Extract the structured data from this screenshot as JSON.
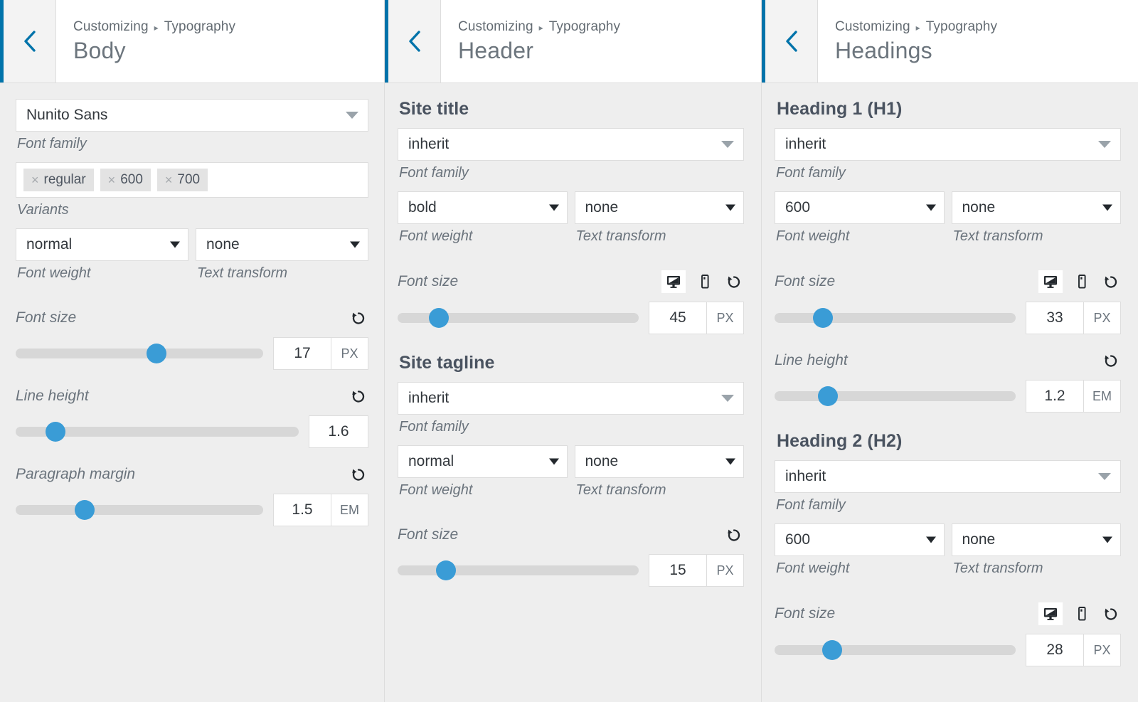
{
  "panels": [
    {
      "accent_color": "#0073aa",
      "back_icon": "chevron-left-icon",
      "breadcrumb": {
        "root": "Customizing",
        "separator": "▸",
        "section": "Typography"
      },
      "title": "Body",
      "font_family": {
        "value": "Nunito Sans",
        "label": "Font family"
      },
      "variants": {
        "chips": [
          "regular",
          "600",
          "700"
        ],
        "remove_glyph": "×",
        "label": "Variants"
      },
      "weight": {
        "value": "normal",
        "label": "Font weight"
      },
      "transform": {
        "value": "none",
        "label": "Text transform"
      },
      "sliders": [
        {
          "label": "Font size",
          "value": "17",
          "unit": "PX",
          "percent": 57,
          "reset_icon": "reset-icon",
          "devices": false
        },
        {
          "label": "Line height",
          "value": "1.6",
          "unit": "",
          "percent": 14,
          "reset_icon": "reset-icon",
          "devices": false
        },
        {
          "label": "Paragraph margin",
          "value": "1.5",
          "unit": "EM",
          "percent": 28,
          "reset_icon": "reset-icon",
          "devices": false
        }
      ]
    },
    {
      "accent_color": "#0073aa",
      "back_icon": "chevron-left-icon",
      "breadcrumb": {
        "root": "Customizing",
        "separator": "▸",
        "section": "Typography"
      },
      "title": "Header",
      "sections": [
        {
          "heading": "Site title",
          "font_family": {
            "value": "inherit",
            "label": "Font family"
          },
          "weight": {
            "value": "bold",
            "label": "Font weight"
          },
          "transform": {
            "value": "none",
            "label": "Text transform"
          },
          "font_size": {
            "label": "Font size",
            "value": "45",
            "unit": "PX",
            "percent": 17,
            "devices": true,
            "desktop_icon": "desktop-icon",
            "mobile_icon": "mobile-icon",
            "active_device": "desktop",
            "reset_icon": "reset-icon"
          }
        },
        {
          "heading": "Site tagline",
          "font_family": {
            "value": "inherit",
            "label": "Font family"
          },
          "weight": {
            "value": "normal",
            "label": "Font weight"
          },
          "transform": {
            "value": "none",
            "label": "Text transform"
          },
          "font_size": {
            "label": "Font size",
            "value": "15",
            "unit": "PX",
            "percent": 20,
            "devices": false,
            "reset_icon": "reset-icon"
          }
        }
      ]
    },
    {
      "accent_color": "#0073aa",
      "back_icon": "chevron-left-icon",
      "breadcrumb": {
        "root": "Customizing",
        "separator": "▸",
        "section": "Typography"
      },
      "title": "Headings",
      "sections": [
        {
          "heading": "Heading 1 (H1)",
          "font_family": {
            "value": "inherit",
            "label": "Font family"
          },
          "weight": {
            "value": "600",
            "label": "Font weight"
          },
          "transform": {
            "value": "none",
            "label": "Text transform"
          },
          "font_size": {
            "label": "Font size",
            "value": "33",
            "unit": "PX",
            "percent": 20,
            "devices": true,
            "desktop_icon": "desktop-icon",
            "mobile_icon": "mobile-icon",
            "active_device": "desktop",
            "reset_icon": "reset-icon"
          },
          "line_height": {
            "label": "Line height",
            "value": "1.2",
            "unit": "EM",
            "percent": 22,
            "devices": false,
            "reset_icon": "reset-icon"
          }
        },
        {
          "heading": "Heading 2 (H2)",
          "font_family": {
            "value": "inherit",
            "label": "Font family"
          },
          "weight": {
            "value": "600",
            "label": "Font weight"
          },
          "transform": {
            "value": "none",
            "label": "Text transform"
          },
          "font_size": {
            "label": "Font size",
            "value": "28",
            "unit": "PX",
            "percent": 24,
            "devices": true,
            "desktop_icon": "desktop-icon",
            "mobile_icon": "mobile-icon",
            "active_device": "desktop",
            "reset_icon": "reset-icon"
          }
        }
      ]
    }
  ]
}
